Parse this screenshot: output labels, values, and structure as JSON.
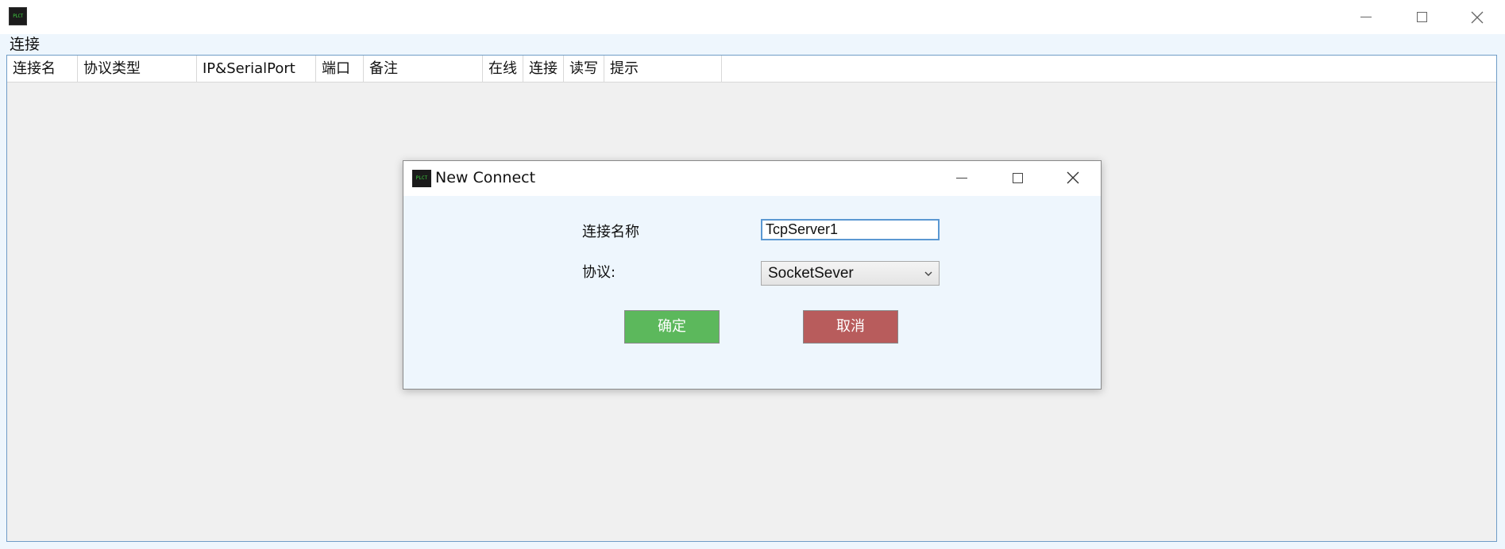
{
  "window": {
    "icon_text": "PLCT",
    "minimize_icon": "minimize-icon",
    "maximize_icon": "maximize-icon",
    "close_icon": "close-icon"
  },
  "groupbox": {
    "label": "连接"
  },
  "grid": {
    "columns": [
      "连接名",
      "协议类型",
      "IP&SerialPort",
      "端口",
      "备注",
      "在线",
      "连接",
      "读写",
      "提示"
    ]
  },
  "dialog": {
    "title": "New Connect",
    "icon_text": "PLCT",
    "name_label": "连接名称",
    "name_value": "TcpServer1",
    "protocol_label": "协议:",
    "protocol_value": "SocketSever",
    "ok_label": "确定",
    "cancel_label": "取消",
    "colors": {
      "ok": "#5cb85c",
      "cancel": "#b85c5c",
      "input_focus": "#5b98d2"
    }
  }
}
